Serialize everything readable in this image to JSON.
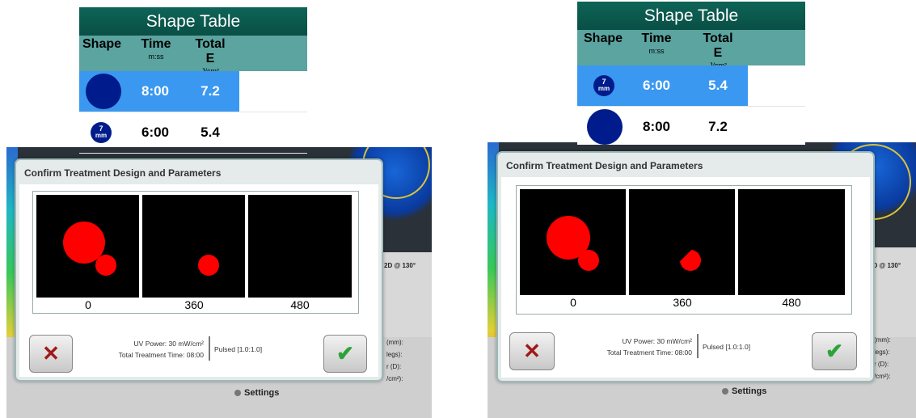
{
  "shape_table": {
    "title": "Shape Table",
    "headers": {
      "shape": "Shape",
      "time": "Time",
      "time_unit": "m:ss",
      "total_e": "Total E",
      "total_e_unit": "J/cm²"
    },
    "left_rows": [
      {
        "shape": "large-circle",
        "time": "8:00",
        "total_e": "7.2",
        "selected": true
      },
      {
        "shape": "7mm-circle",
        "shape_label_top": "7",
        "shape_label_bottom": "mm",
        "time": "6:00",
        "total_e": "5.4",
        "selected": false
      }
    ],
    "right_rows": [
      {
        "shape": "7mm-circle",
        "shape_label_top": "7",
        "shape_label_bottom": "mm",
        "time": "6:00",
        "total_e": "5.4",
        "selected": true
      },
      {
        "shape": "large-circle",
        "time": "8:00",
        "total_e": "7.2",
        "selected": false
      }
    ]
  },
  "dialog": {
    "title": "Confirm Treatment Design and Parameters",
    "frame_labels": [
      "0",
      "360",
      "480"
    ],
    "uv_power_label": "UV Power:",
    "uv_power_value": "30 mW/cm²",
    "total_time_label": "Total Treatment Time:",
    "total_time_value": "08:00",
    "pulse_mode": "Pulsed [1.0:1.0]",
    "cancel_icon": "x-icon",
    "confirm_icon": "check-icon"
  },
  "background_app": {
    "settings_label": "Settings",
    "right_info": "2D @ 130°",
    "left_side_labels": [
      "(mm):",
      "legs):",
      "r (D):",
      "/cm²):"
    ],
    "right_side_labels": [
      "(mm):",
      "legs):",
      "r (D):",
      "/cm²):"
    ]
  },
  "colors": {
    "table_title_bg": "#0d6457",
    "table_header_bg": "#5ba4a0",
    "selected_row": "#3a98f0",
    "shape_fill": "#001c8c",
    "treatment_red": "#ff0000",
    "cancel_red": "#a01818",
    "confirm_green": "#2ea23a"
  }
}
